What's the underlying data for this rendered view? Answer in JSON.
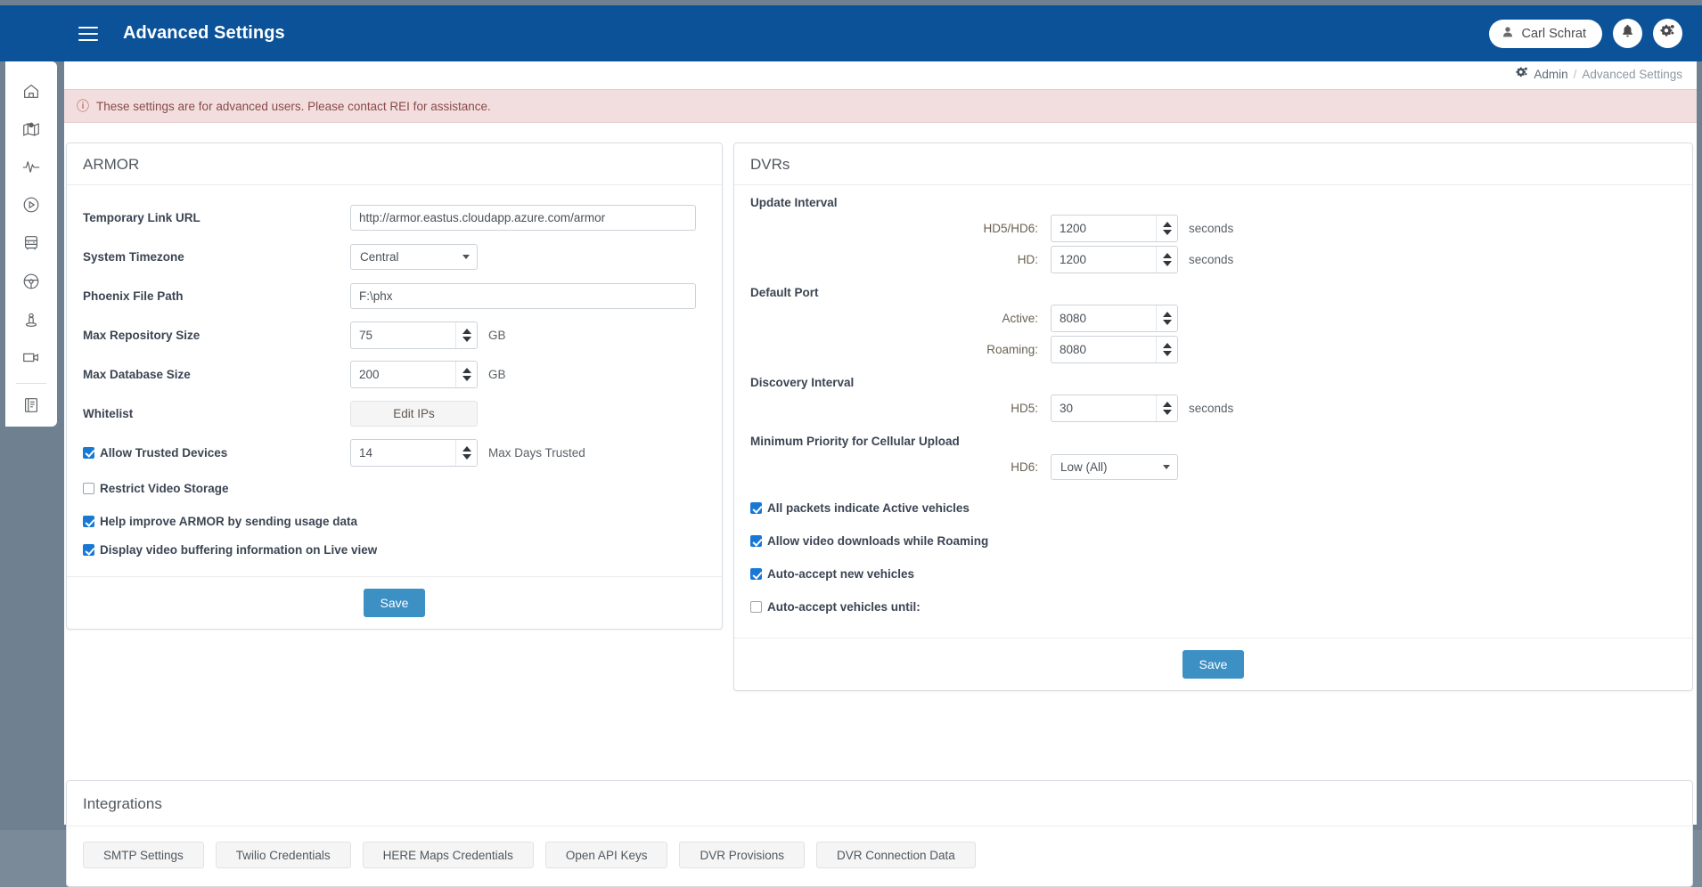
{
  "header": {
    "title": "Advanced Settings",
    "menu_icon": "hamburger-icon",
    "user_name": "Carl Schrat",
    "bell_icon": "bell-icon",
    "settings_icon": "gear-cogs-icon",
    "brand_color": "#0b5299"
  },
  "breadcrumb": {
    "icon": "gear-cogs-icon",
    "root": "Admin",
    "separator": "/",
    "current": "Advanced Settings"
  },
  "alert": {
    "icon": "exclamation-circle-icon",
    "message": "These settings are for advanced users. Please contact REI for assistance.",
    "bg_color": "#f2dede",
    "text_color": "#8a4a4a"
  },
  "sidebar": {
    "items": [
      {
        "icon": "home-icon",
        "name": "sidebar-item-home"
      },
      {
        "icon": "map-pin-icon",
        "name": "sidebar-item-map"
      },
      {
        "icon": "pulse-icon",
        "name": "sidebar-item-health"
      },
      {
        "icon": "play-circle-icon",
        "name": "sidebar-item-playback"
      },
      {
        "icon": "bus-icon",
        "name": "sidebar-item-vehicles"
      },
      {
        "icon": "steering-wheel-icon",
        "name": "sidebar-item-drivers"
      },
      {
        "icon": "person-pin-icon",
        "name": "sidebar-item-passengers"
      },
      {
        "icon": "video-camera-icon",
        "name": "sidebar-item-cameras"
      },
      {
        "icon": "book-icon",
        "name": "sidebar-item-reports"
      }
    ]
  },
  "armor": {
    "title": "ARMOR",
    "fields": {
      "temp_link_label": "Temporary Link URL",
      "temp_link_value": "http://armor.eastus.cloudapp.azure.com/armor",
      "temp_link_placeholder": "",
      "timezone_label": "System Timezone",
      "timezone_value": "Central",
      "phoenix_label": "Phoenix File Path",
      "phoenix_value": "F:\\phx",
      "phoenix_placeholder": "",
      "max_repo_label": "Max Repository Size",
      "max_repo_value": "75",
      "max_repo_unit": "GB",
      "max_db_label": "Max Database Size",
      "max_db_value": "200",
      "max_db_unit": "GB",
      "whitelist_label": "Whitelist",
      "whitelist_button": "Edit IPs",
      "trusted_label": "Allow Trusted Devices",
      "trusted_checked": true,
      "trusted_days_value": "14",
      "trusted_days_unit": "Max Days Trusted",
      "restrict_label": "Restrict Video Storage",
      "restrict_checked": false,
      "usage_label": "Help improve ARMOR by sending usage data",
      "usage_checked": true,
      "buffering_label": "Display video buffering information on Live view",
      "buffering_checked": true
    },
    "save_label": "Save"
  },
  "dvrs": {
    "title": "DVRs",
    "update_interval": {
      "label": "Update Interval",
      "rows": [
        {
          "key": "HD5/HD6:",
          "value": "1200",
          "unit": "seconds"
        },
        {
          "key": "HD:",
          "value": "1200",
          "unit": "seconds"
        }
      ]
    },
    "default_port": {
      "label": "Default Port",
      "rows": [
        {
          "key": "Active:",
          "value": "8080",
          "unit": ""
        },
        {
          "key": "Roaming:",
          "value": "8080",
          "unit": ""
        }
      ]
    },
    "discovery_interval": {
      "label": "Discovery Interval",
      "rows": [
        {
          "key": "HD5:",
          "value": "30",
          "unit": "seconds"
        }
      ]
    },
    "cellular_priority": {
      "label": "Minimum Priority for Cellular Upload",
      "key": "HD6:",
      "value": "Low (All)",
      "options": [
        "Low (All)"
      ]
    },
    "checkboxes": [
      {
        "label": "All packets indicate Active vehicles",
        "checked": true
      },
      {
        "label": "Allow video downloads while Roaming",
        "checked": true
      },
      {
        "label": "Auto-accept new vehicles",
        "checked": true
      },
      {
        "label": "Auto-accept vehicles until:",
        "checked": false
      }
    ],
    "save_label": "Save"
  },
  "integrations": {
    "title": "Integrations",
    "buttons": [
      "SMTP Settings",
      "Twilio Credentials",
      "HERE Maps Credentials",
      "Open API Keys",
      "DVR Provisions",
      "DVR Connection Data"
    ]
  },
  "colors": {
    "accent": "#3d90c4",
    "brand": "#0b5299",
    "checkbox": "#1878d4"
  }
}
